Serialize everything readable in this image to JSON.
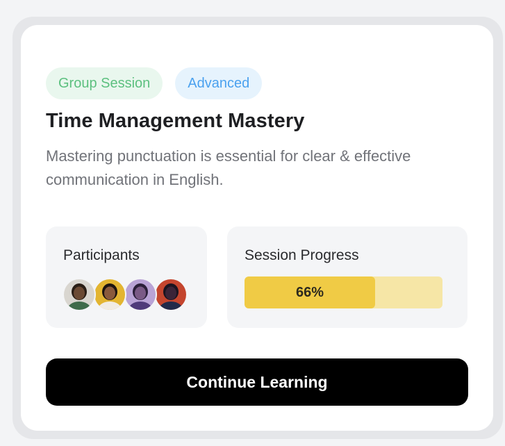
{
  "course": {
    "tags": [
      {
        "label": "Group Session",
        "kind": "session-type"
      },
      {
        "label": "Advanced",
        "kind": "level"
      }
    ],
    "title": "Time Management Mastery",
    "description": "Mastering punctuation is essential for clear & effective communication in English."
  },
  "participants": {
    "label": "Participants",
    "avatars": [
      {
        "name": "participant-1",
        "bg": "#d9d6d0",
        "skin": "#6b4a34",
        "hair": "#2a1e16",
        "shirt": "#3f6b4a"
      },
      {
        "name": "participant-2",
        "bg": "#e3b531",
        "skin": "#8a5a3c",
        "hair": "#1c1410",
        "shirt": "#f1ece4"
      },
      {
        "name": "participant-3",
        "bg": "#b9a3d6",
        "skin": "#7a5a86",
        "hair": "#2b1f3a",
        "shirt": "#4f3a7a"
      },
      {
        "name": "participant-4",
        "bg": "#c4452e",
        "skin": "#3a2438",
        "hair": "#1a1420",
        "shirt": "#222a4a"
      }
    ]
  },
  "progress": {
    "label": "Session Progress",
    "percent": 66,
    "percent_text": "66%"
  },
  "actions": {
    "continue_label": "Continue Learning"
  },
  "colors": {
    "progress_fill": "#f0cb45",
    "progress_track": "#f6e6a6",
    "cta_background": "#000000"
  }
}
